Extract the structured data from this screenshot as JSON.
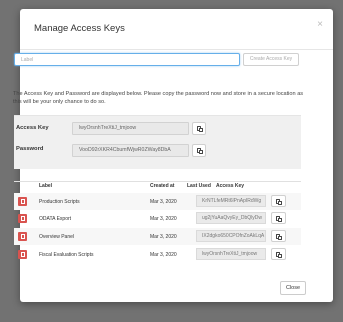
{
  "modal": {
    "title": "Manage Access Keys",
    "close_icon": "×",
    "label_placeholder": "Label",
    "create_button": "Create Access Key",
    "notice": "The Access Key and Password are displayed below. Please copy the password now and store in a secure location as this will be your only chance to do so.",
    "access_key_label": "Access Key",
    "access_key_value": "lwyOrsnhTreXtiJ_tmjoow",
    "password_label": "Password",
    "password_value": "VooD92rXKR4CbumfWjwR0ZWay8DbA",
    "close_button": "Close"
  },
  "table": {
    "headers": {
      "label": "Label",
      "created": "Created at",
      "last_used": "Last Used",
      "access_key": "Access Key"
    },
    "rows": [
      {
        "label": "Production Scripts",
        "created": "Mar 3, 2020",
        "last_used": "",
        "access_key": "KrNTLfeMRt6lPnApIRdWg"
      },
      {
        "label": "ODATA Export",
        "created": "Mar 3, 2020",
        "last_used": "",
        "access_key": "ug2jYuAaQvyEy_DbQlyDw"
      },
      {
        "label": "Overview Panel",
        "created": "Mar 3, 2020",
        "last_used": "",
        "access_key": "IX2dgko650CPOfnZoAkLqA"
      },
      {
        "label": "Fiscal Evaluation Scripts",
        "created": "Mar 3, 2020",
        "last_used": "",
        "access_key": "lwyOrsnhTreXtiJ_tmjoow"
      }
    ]
  },
  "icons": {
    "close": "close-icon",
    "copy": "clipboard-icon",
    "delete": "trash-icon"
  },
  "colors": {
    "delete_button": "#d9534f",
    "input_focus": "#66afe9",
    "backdrop": "#727272"
  }
}
